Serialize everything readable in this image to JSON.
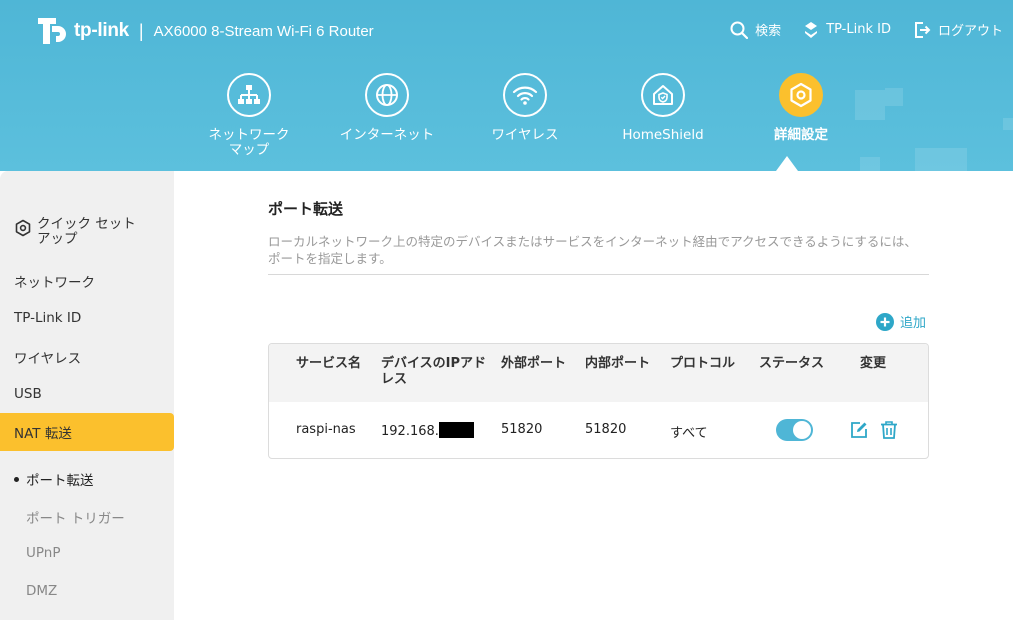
{
  "header": {
    "brand": "tp-link",
    "separator": "|",
    "model": "AX6000 8-Stream Wi-Fi 6 Router",
    "links": [
      {
        "label": "検索",
        "icon": "search-icon"
      },
      {
        "label": "TP-Link ID",
        "icon": "user-id-icon"
      },
      {
        "label": "ログアウト",
        "icon": "logout-icon"
      }
    ]
  },
  "nav": [
    {
      "label": "ネットワーク\nマップ",
      "icon": "network-map-icon",
      "active": false
    },
    {
      "label": "インターネット",
      "icon": "globe-icon",
      "active": false
    },
    {
      "label": "ワイヤレス",
      "icon": "wifi-icon",
      "active": false
    },
    {
      "label": "HomeShield",
      "icon": "homeshield-icon",
      "active": false
    },
    {
      "label": "詳細設定",
      "icon": "gear-icon",
      "active": true
    }
  ],
  "sidebar": {
    "items": [
      {
        "label": "クイック セット\nアップ",
        "icon": "gear-icon"
      },
      {
        "label": "ネットワーク"
      },
      {
        "label": "TP-Link ID"
      },
      {
        "label": "ワイヤレス"
      },
      {
        "label": "USB"
      },
      {
        "label": "NAT 転送",
        "active": true
      }
    ],
    "sub_items": [
      {
        "label": "ポート転送",
        "current": true
      },
      {
        "label": "ポート トリガー"
      },
      {
        "label": "UPnP"
      },
      {
        "label": "DMZ"
      }
    ]
  },
  "main": {
    "title": "ポート転送",
    "description": "ローカルネットワーク上の特定のデバイスまたはサービスをインターネット経由でアクセスできるようにするには、ポートを指定します。",
    "add_label": "追加"
  },
  "table": {
    "headers": [
      "サービス名",
      "デバイスのIPアドレス",
      "外部ポート",
      "内部ポート",
      "プロトコル",
      "ステータス",
      "変更"
    ],
    "rows": [
      {
        "service": "raspi-nas",
        "ip": "192.168.",
        "external_port": "51820",
        "internal_port": "51820",
        "protocol": "すべて",
        "status_on": true
      }
    ]
  },
  "colors": {
    "header_bg": "#4fb6d6",
    "accent_yellow": "#fbc02d",
    "link_blue": "#2ea7c8"
  }
}
